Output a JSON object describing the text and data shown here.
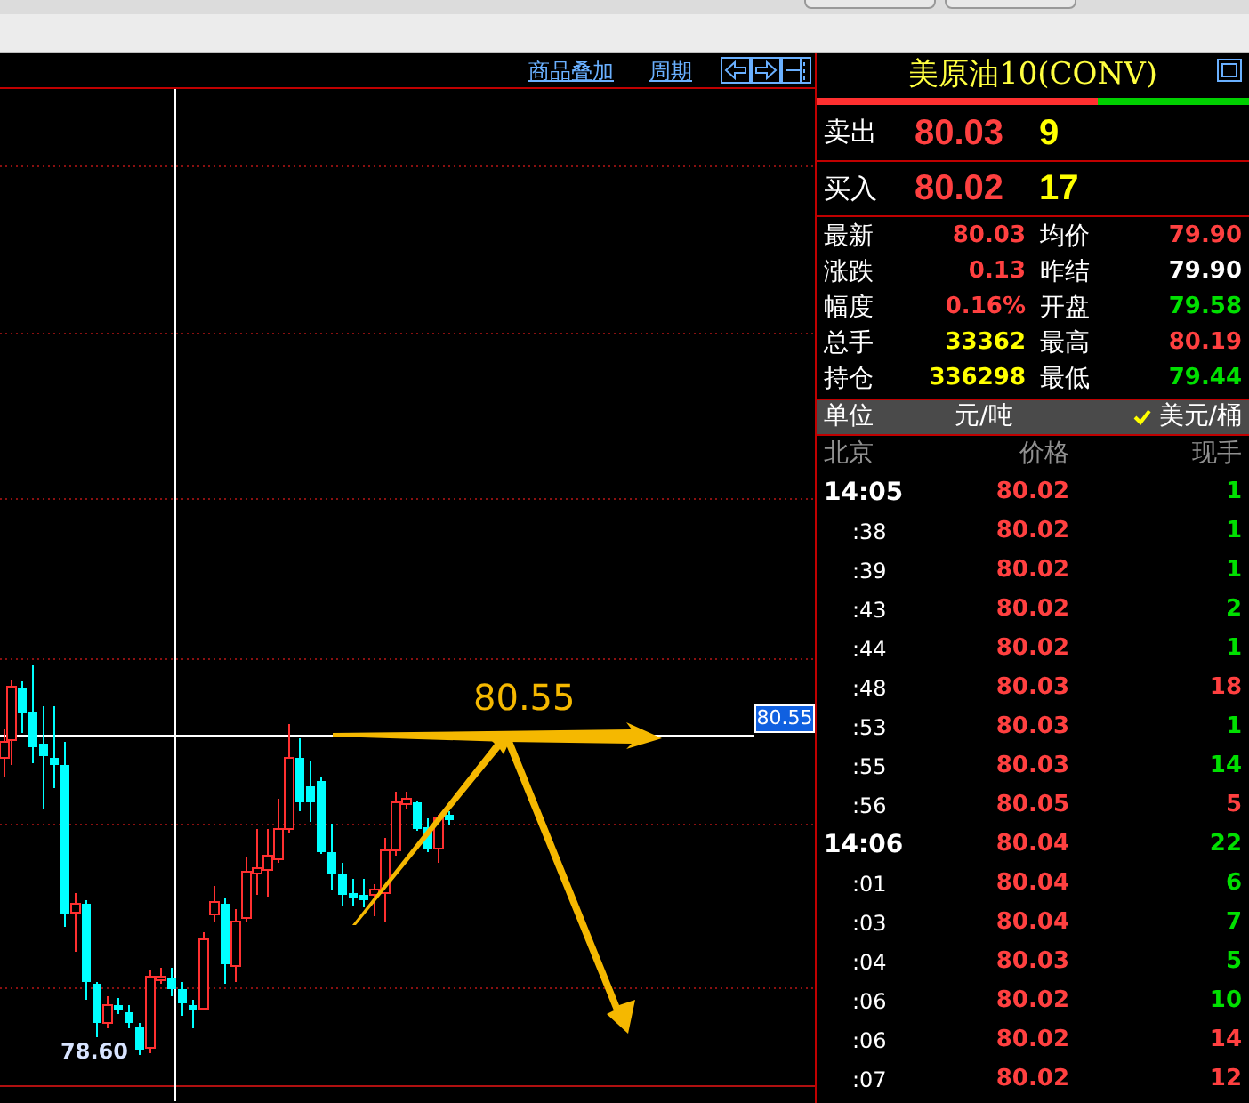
{
  "chart": {
    "links": [
      "商品叠加",
      "周期"
    ],
    "price_tag": "80.55",
    "annotation": "80.55",
    "low_label": "78.60"
  },
  "quote": {
    "title": "美原油10(CONV)",
    "ratio_bar": {
      "level": 0.65
    },
    "sell": {
      "label": "卖出",
      "price": "80.03",
      "volume": "9"
    },
    "buy": {
      "label": "买入",
      "price": "80.02",
      "volume": "17"
    },
    "stats": [
      {
        "label": "最新",
        "value": "80.03",
        "color": "#ff4040"
      },
      {
        "label": "均价",
        "value": "79.90",
        "color": "#ff4040"
      },
      {
        "label": "涨跌",
        "value": "0.13",
        "color": "#ff4040"
      },
      {
        "label": "昨结",
        "value": "79.90",
        "color": "#ffffff"
      },
      {
        "label": "幅度",
        "value": "0.16%",
        "color": "#ff4040"
      },
      {
        "label": "开盘",
        "value": "79.58",
        "color": "#00e000"
      },
      {
        "label": "总手",
        "value": "33362",
        "color": "#ffff00"
      },
      {
        "label": "最高",
        "value": "80.19",
        "color": "#ff4040"
      },
      {
        "label": "持仓",
        "value": "336298",
        "color": "#ffff00"
      },
      {
        "label": "最低",
        "value": "79.44",
        "color": "#00e000"
      }
    ],
    "unit": {
      "label": "单位",
      "options": [
        {
          "label": "元/吨",
          "selected": false
        },
        {
          "label": "美元/桶",
          "selected": true
        }
      ]
    },
    "ticks": {
      "columns": [
        "北京",
        "价格",
        "现手"
      ],
      "rows": [
        {
          "time": "14:05",
          "kind": "minute",
          "price": "80.02",
          "volume": "1",
          "color": "#00e000"
        },
        {
          "time": ":38",
          "kind": "second",
          "price": "80.02",
          "volume": "1",
          "color": "#00e000"
        },
        {
          "time": ":39",
          "kind": "second",
          "price": "80.02",
          "volume": "1",
          "color": "#00e000"
        },
        {
          "time": ":43",
          "kind": "second",
          "price": "80.02",
          "volume": "2",
          "color": "#00e000"
        },
        {
          "time": ":44",
          "kind": "second",
          "price": "80.02",
          "volume": "1",
          "color": "#00e000"
        },
        {
          "time": ":48",
          "kind": "second",
          "price": "80.03",
          "volume": "18",
          "color": "#ff4040"
        },
        {
          "time": ":53",
          "kind": "second",
          "price": "80.03",
          "volume": "1",
          "color": "#00e000"
        },
        {
          "time": ":55",
          "kind": "second",
          "price": "80.03",
          "volume": "14",
          "color": "#00e000"
        },
        {
          "time": ":56",
          "kind": "second",
          "price": "80.05",
          "volume": "5",
          "color": "#ff4040"
        },
        {
          "time": "14:06",
          "kind": "minute",
          "price": "80.04",
          "volume": "22",
          "color": "#00e000"
        },
        {
          "time": ":01",
          "kind": "second",
          "price": "80.04",
          "volume": "6",
          "color": "#00e000"
        },
        {
          "time": ":03",
          "kind": "second",
          "price": "80.04",
          "volume": "7",
          "color": "#00e000"
        },
        {
          "time": ":04",
          "kind": "second",
          "price": "80.03",
          "volume": "5",
          "color": "#00e000"
        },
        {
          "time": ":06",
          "kind": "second",
          "price": "80.02",
          "volume": "10",
          "color": "#00e000"
        },
        {
          "time": ":06",
          "kind": "second",
          "price": "80.02",
          "volume": "14",
          "color": "#ff4040"
        },
        {
          "time": ":07",
          "kind": "second",
          "price": "80.02",
          "volume": "12",
          "color": "#ff4040"
        }
      ]
    }
  }
}
